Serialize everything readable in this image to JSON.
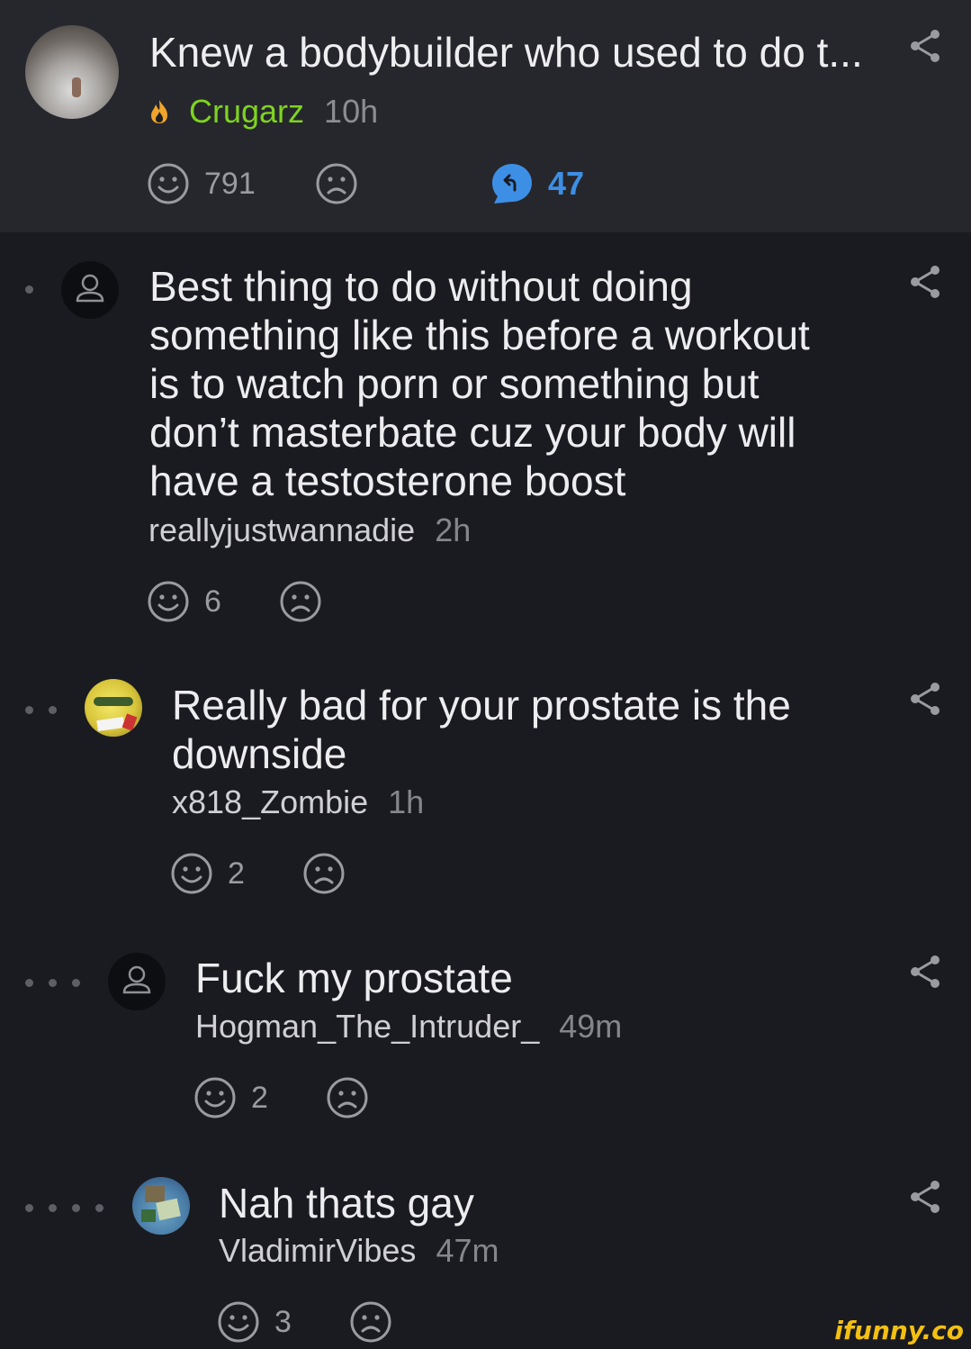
{
  "post": {
    "title": "Knew a bodybuilder who used to do t...",
    "author": "Crugarz",
    "time": "10h",
    "smiles": "791",
    "replies": "47"
  },
  "comments": [
    {
      "text": "Best thing to do without doing something like this before a workout is to watch porn or something but don’t masterbate cuz your body will have a testosterone boost",
      "author": "reallyjustwannadie",
      "time": "2h",
      "smiles": "6",
      "depth": 1
    },
    {
      "text": "Really bad for your prostate is the downside",
      "author": "x818_Zombie",
      "time": "1h",
      "smiles": "2",
      "depth": 2
    },
    {
      "text": "Fuck my prostate",
      "author": "Hogman_The_Intruder_",
      "time": "49m",
      "smiles": "2",
      "depth": 3
    },
    {
      "text": "Nah thats gay",
      "author": "VladimirVibes",
      "time": "47m",
      "smiles": "3",
      "depth": 4
    }
  ],
  "icons": {
    "smile": "smile-face-icon",
    "unsmile": "sad-face-icon",
    "share": "share-icon",
    "reply": "reply-bubble-icon",
    "flame": "flame-icon",
    "user": "default-user-icon"
  },
  "colors": {
    "author_highlight": "#7ed321",
    "reply_accent": "#3d8fe6",
    "watermark": "#f3c012"
  },
  "watermark": "ifunny.co"
}
